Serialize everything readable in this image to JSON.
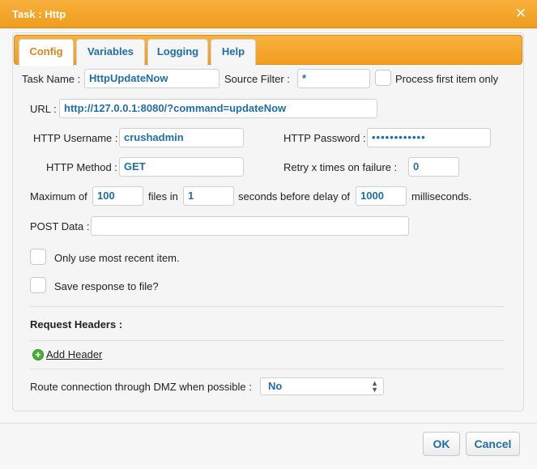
{
  "window": {
    "title": "Task : Http",
    "close_icon": "✕"
  },
  "tabs": [
    {
      "label": "Config",
      "active": true
    },
    {
      "label": "Variables"
    },
    {
      "label": "Logging"
    },
    {
      "label": "Help"
    }
  ],
  "form": {
    "task_name_label": "Task Name :",
    "task_name_value": "HttpUpdateNow",
    "source_filter_label": "Source Filter :",
    "source_filter_value": "*",
    "process_first_label": "Process first item only",
    "url_label": "URL :",
    "url_value": "http://127.0.0.1:8080/?command=updateNow",
    "username_label": "HTTP Username :",
    "username_value": "crushadmin",
    "password_label": "HTTP Password :",
    "password_value": "••••••••••••",
    "method_label": "HTTP Method :",
    "method_value": "GET",
    "retry_label": "Retry x times on failure :",
    "retry_value": "0",
    "max_label": "Maximum of",
    "max_value": "100",
    "files_in_label": "files in",
    "files_in_value": "1",
    "seconds_label": "seconds before delay of",
    "delay_value": "1000",
    "ms_label": "milliseconds.",
    "post_label": "POST Data :",
    "post_value": "",
    "recent_label": "Only use most recent item.",
    "save_label": "Save response to file?",
    "headers_label": "Request Headers :",
    "add_header_label": "Add Header",
    "dmz_label": "Route connection through DMZ when possible :",
    "dmz_value": "No"
  },
  "buttons": {
    "ok": "OK",
    "cancel": "Cancel"
  },
  "colors": {
    "accent": "#f19e1f",
    "value_text": "#1f6ea8"
  }
}
